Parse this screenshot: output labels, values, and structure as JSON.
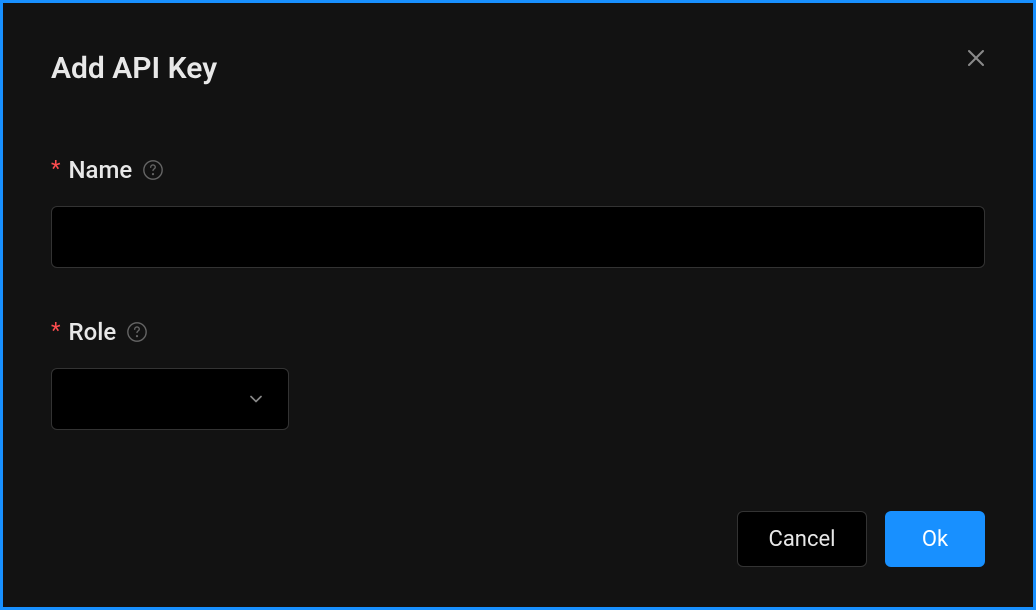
{
  "modal": {
    "title": "Add API Key"
  },
  "fields": {
    "name": {
      "label": "Name",
      "required": "*",
      "value": ""
    },
    "role": {
      "label": "Role",
      "required": "*",
      "value": ""
    }
  },
  "buttons": {
    "cancel": "Cancel",
    "ok": "Ok"
  }
}
